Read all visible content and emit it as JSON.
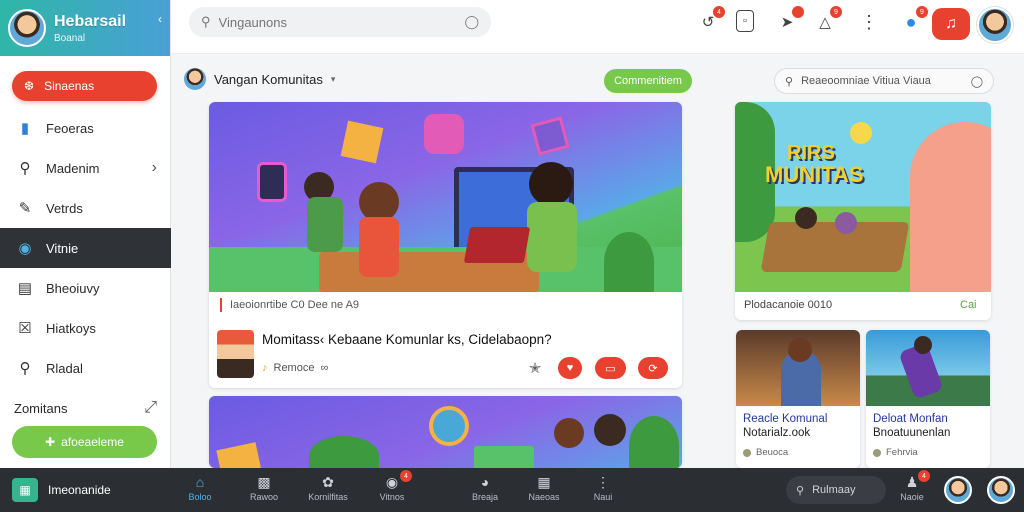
{
  "brand": {
    "name": "Hebarsail",
    "sub": "Boanal",
    "caret": "‹"
  },
  "sidebar": {
    "primary_button": "Sinaenas",
    "items": [
      {
        "label": "Feoeras",
        "icon": "folder-icon"
      },
      {
        "label": "Madenim",
        "icon": "search-icon",
        "chevron": "›"
      },
      {
        "label": "Vetrds",
        "icon": "pencil-icon"
      },
      {
        "label": "Vitnie",
        "icon": "globe-icon",
        "active": true
      },
      {
        "label": "Bheoiuvy",
        "icon": "book-icon"
      },
      {
        "label": "Hiatkoys",
        "icon": "close-box-icon"
      },
      {
        "label": "Rladal",
        "icon": "search-icon"
      },
      {
        "label": "Zomitans",
        "icon": "arrow-icon"
      }
    ],
    "green_button": "afoeaeleme"
  },
  "topbar": {
    "search_placeholder": "Vingaunons",
    "badges": {
      "b1": "4",
      "b3": "9",
      "b4": "9",
      "b6": "4"
    }
  },
  "channel": {
    "name": "Vangan Komunitas",
    "caret": "▾",
    "follow_label": "Commenitiem"
  },
  "right_search": {
    "text": "Reaeoomniae Vitiua Viaua"
  },
  "main_post": {
    "meta": "Iaeoionrtibe C0 Dee ne A9",
    "title": "Momitass‹ Kebaane Komunlar ks, Cidelabaopn?",
    "author": "Remoce"
  },
  "side_card": {
    "title_line1": "RIRS",
    "title_line2": "MUNITAS",
    "meta_left": "Plodacanoie 0010",
    "meta_right": "Cai"
  },
  "mini_cards": [
    {
      "title": "Reacle Komunal",
      "sub": "Notarialz.ook",
      "foot": "Beuoca"
    },
    {
      "title": "Deloat Monfan",
      "sub": "Bnoatuunenlan",
      "foot": "Fehrvia"
    }
  ],
  "bottombar": {
    "left_label": "Imeonanide",
    "items": [
      {
        "label": "Boloo",
        "icon": "home-icon",
        "active": true
      },
      {
        "label": "Rawoo",
        "icon": "chat-icon"
      },
      {
        "label": "Kornilfitas",
        "icon": "group-icon"
      },
      {
        "label": "Vitnos",
        "icon": "video-icon",
        "badge": "4"
      },
      {
        "label": "Breaja",
        "icon": "gamepad-icon"
      },
      {
        "label": "Naeoas",
        "icon": "image-icon"
      },
      {
        "label": "Naui",
        "icon": "more-icon"
      }
    ],
    "search_text": "Rulmaay",
    "right_item": {
      "label": "Naoie",
      "icon": "people-icon",
      "badge": "4"
    }
  },
  "colors": {
    "accent_red": "#e8412f",
    "accent_green": "#78c84a",
    "accent_blue": "#4fb3e8",
    "dark_bar": "#2b2e33"
  }
}
